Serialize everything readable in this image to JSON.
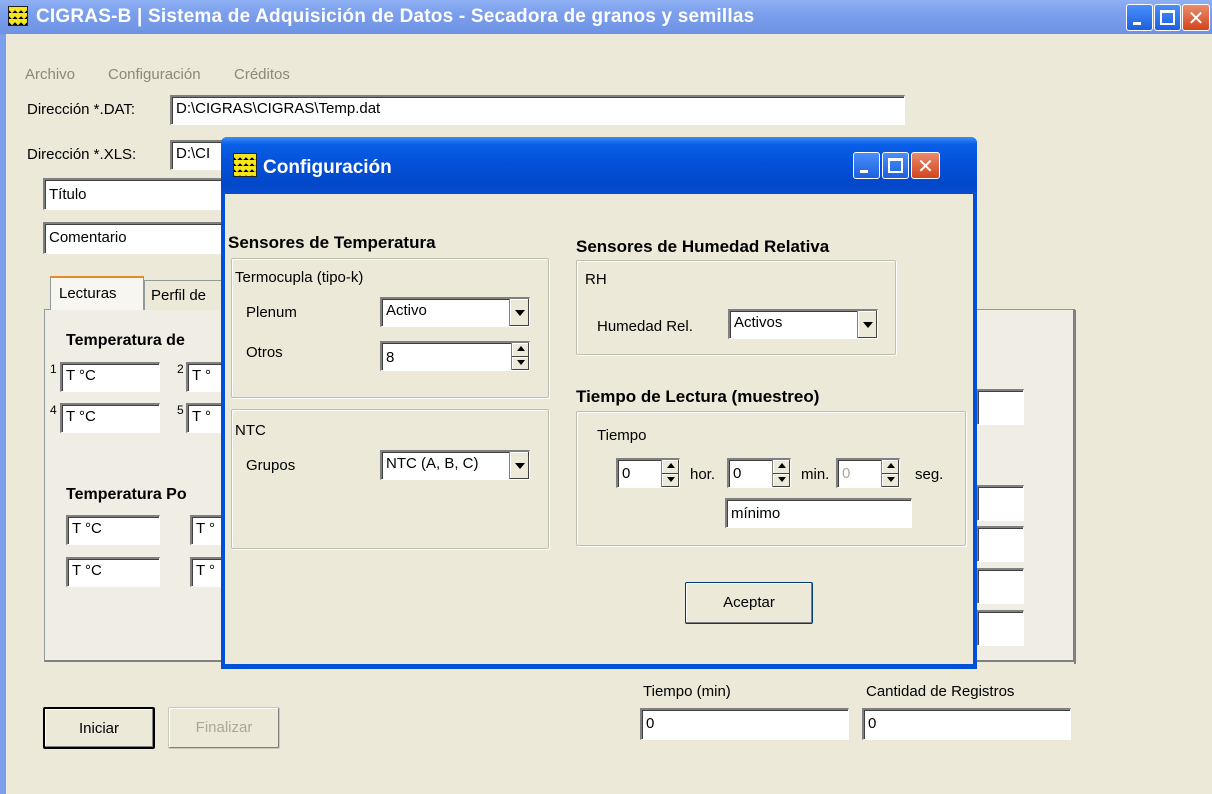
{
  "main_window": {
    "title": "CIGRAS-B | Sistema de Adquisición de Datos - Secadora de granos y semillas",
    "menu": [
      "Archivo",
      "Configuración",
      "Créditos"
    ],
    "dat_label": "Dirección *.DAT:",
    "dat_value": "D:\\CIGRAS\\CIGRAS\\Temp.dat",
    "xls_label": "Dirección *.XLS:",
    "xls_value": "D:\\CI",
    "titulo_value": "Título",
    "comentario_value": "Comentario",
    "tabs": [
      "Lecturas",
      "Perfil de"
    ],
    "temp_section_1": "Temperatura de",
    "temp_section_2": "Temperatura Po",
    "sensor_nums": [
      "1",
      "2",
      "4",
      "5"
    ],
    "temp_placeholder": "T °C",
    "temp_partial": "T °",
    "tiempo_label": "Tiempo (min)",
    "tiempo_value": "0",
    "registros_label": "Cantidad de Registros",
    "registros_value": "0",
    "iniciar": "Iniciar",
    "finalizar": "Finalizar"
  },
  "dialog": {
    "title": "Configuración",
    "temp_heading": "Sensores de Temperatura",
    "termocupla_group": "Termocupla (tipo-k)",
    "plenum_label": "Plenum",
    "plenum_value": "Activo",
    "otros_label": "Otros",
    "otros_value": "8",
    "ntc_group": "NTC",
    "grupos_label": "Grupos",
    "grupos_value": "NTC (A, B, C)",
    "hum_heading": "Sensores de Humedad Relativa",
    "rh_group": "RH",
    "humedad_label": "Humedad Rel.",
    "humedad_value": "Activos",
    "tiempo_heading": "Tiempo de Lectura (muestreo)",
    "tiempo_group": "Tiempo",
    "hor_value": "0",
    "hor_label": "hor.",
    "min_value": "0",
    "min_label": "min.",
    "seg_value": "0",
    "seg_label": "seg.",
    "minimo": "mínimo",
    "aceptar": "Aceptar"
  },
  "colors": {
    "titlebar": "#0350d8",
    "inactive_titlebar": "#7b9fec",
    "window_bg": "#ece9d8",
    "close_button": "#d2451c"
  }
}
